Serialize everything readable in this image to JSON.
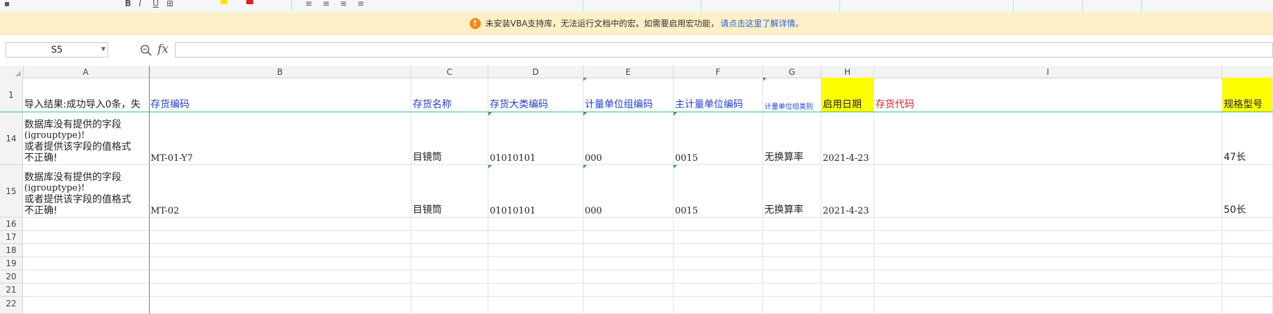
{
  "warning": {
    "icon": "warning-icon",
    "message": "未安装VBA支持库，无法运行文档中的宏。如需要启用宏功能，",
    "link": "请点击这里了解详情。",
    "bg": "#fdf0c6"
  },
  "formula_bar": {
    "name_box": "S5",
    "fx_label": "fx",
    "formula": ""
  },
  "columns": [
    "A",
    "B",
    "C",
    "D",
    "E",
    "F",
    "G",
    "H",
    "I"
  ],
  "rows": {
    "r1": {
      "num": "1",
      "A": "导入结果:成功导入0条，失",
      "B": "存货编码",
      "C": "存货名称",
      "D": "存货大类编码",
      "E": "计量单位组编码",
      "F": "主计量单位编码",
      "G": "计量单位组类别",
      "H": "启用日期",
      "I": "存货代码",
      "J": "规格型号"
    },
    "r14": {
      "num": "14",
      "A_lines": [
        "数据库没有提供的字段",
        "(igrouptype)!",
        "或者提供该字段的值格式",
        "不正确!"
      ],
      "B": "MT-01-Y7",
      "C": "目镜筒",
      "D": "01010101",
      "E": "000",
      "F": "0015",
      "G": "无换算率",
      "H": "2021-4-23",
      "I": "",
      "J": "47长"
    },
    "r15": {
      "num": "15",
      "A_lines": [
        "数据库没有提供的字段",
        "(igrouptype)!",
        "或者提供该字段的值格式",
        "不正确!"
      ],
      "B": "MT-02",
      "C": "目镜筒",
      "D": "01010101",
      "E": "000",
      "F": "0015",
      "G": "无换算率",
      "H": "2021-4-23",
      "I": "",
      "J": "50长"
    },
    "empty_rows": [
      "16",
      "17",
      "18",
      "19",
      "20",
      "21",
      "22"
    ]
  },
  "colors": {
    "header_blue": "#1f3fd0",
    "header_red": "#e02020",
    "highlight_yellow": "#ffff00",
    "freeze_line": "#3fb98b"
  }
}
